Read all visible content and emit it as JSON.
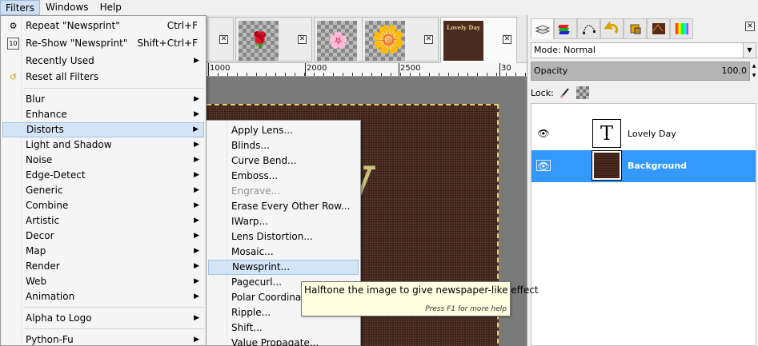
{
  "menubar": {
    "items": [
      "Filters",
      "Windows",
      "Help"
    ]
  },
  "filters_menu": {
    "repeat": {
      "label": "Repeat \"Newsprint\"",
      "shortcut": "Ctrl+F"
    },
    "reshow": {
      "label": "Re-Show \"Newsprint\"",
      "shortcut": "Shift+Ctrl+F"
    },
    "recently_used": "Recently Used",
    "reset_all": "Reset all Filters",
    "groups": [
      "Blur",
      "Enhance",
      "Distorts",
      "Light and Shadow",
      "Noise",
      "Edge-Detect",
      "Generic",
      "Combine",
      "Artistic",
      "Decor",
      "Map",
      "Render",
      "Web",
      "Animation"
    ],
    "alpha_to_logo": "Alpha to Logo",
    "python_fu": "Python-Fu"
  },
  "distorts_menu": {
    "items": [
      "Apply Lens...",
      "Blinds...",
      "Curve Bend...",
      "Emboss...",
      "Engrave...",
      "Erase Every Other Row...",
      "IWarp...",
      "Lens Distortion...",
      "Mosaic...",
      "Newsprint...",
      "Pagecurl...",
      "Polar Coordinates...",
      "Ripple...",
      "Shift...",
      "Value Propagate..."
    ],
    "disabled_index": 4,
    "highlighted_index": 9
  },
  "tooltip": {
    "text": "Halftone the image to give newspaper-like effect",
    "help": "Press F1 for more help"
  },
  "image_tabs": {
    "close_glyph": "✕",
    "active_thumb_label": "Lovely Day",
    "thumb_icons": [
      "🌹",
      "🌸",
      "🌼"
    ]
  },
  "ruler": {
    "labels": [
      "1000",
      "2000",
      "2500",
      "30"
    ]
  },
  "canvas": {
    "text": "ay"
  },
  "dock": {
    "mode_label": "Mode: Normal",
    "opacity_label": "Opacity",
    "opacity_value": "100.0",
    "lock_label": "Lock:",
    "layers": [
      {
        "name": "Lovely Day",
        "thumb": "T"
      },
      {
        "name": "Background",
        "thumb": ""
      }
    ],
    "selected_layer": 1
  },
  "colors": {
    "selection": "#3399ff",
    "menu_highlight": "#d3e4f7",
    "tooltip_bg": "#ffffe1",
    "wood": "#4a2a1e"
  }
}
